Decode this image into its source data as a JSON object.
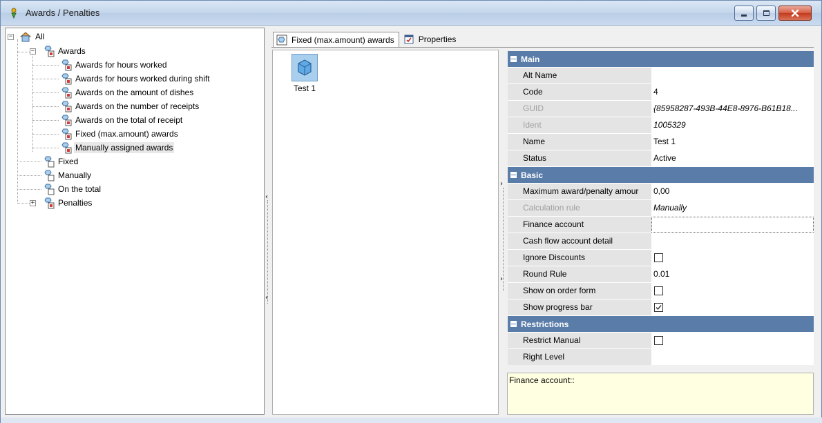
{
  "window": {
    "title": "Awards / Penalties"
  },
  "tree": {
    "root": "All",
    "awards": "Awards",
    "award_children": [
      "Awards for hours worked",
      "Awards for hours worked during shift",
      "Awards on the amount of dishes",
      "Awards on the number of receipts",
      "Awards on the total of receipt",
      "Fixed (max.amount) awards",
      "Manually assigned awards"
    ],
    "siblings": [
      "Fixed",
      "Manually",
      "On the total"
    ],
    "penalties": "Penalties"
  },
  "tabs": [
    {
      "label": "Fixed (max.amount) awards"
    },
    {
      "label": "Properties"
    }
  ],
  "center": {
    "items": [
      {
        "label": "Test 1"
      }
    ]
  },
  "properties": {
    "main": {
      "title": "Main",
      "rows": [
        {
          "name": "Alt Name",
          "value": ""
        },
        {
          "name": "Code",
          "value": "4"
        },
        {
          "name": "GUID",
          "value": "{85958287-493B-44E8-8976-B61B18..."
        },
        {
          "name": "Ident",
          "value": "1005329"
        },
        {
          "name": "Name",
          "value": "Test 1"
        },
        {
          "name": "Status",
          "value": "Active"
        }
      ]
    },
    "basic": {
      "title": "Basic",
      "rows": [
        {
          "name": "Maximum award/penalty amour",
          "value": "0,00"
        },
        {
          "name": "Calculation rule",
          "value": "Manually"
        },
        {
          "name": "Finance account",
          "value": ""
        },
        {
          "name": "Cash flow account detail",
          "value": ""
        },
        {
          "name": "Ignore Discounts",
          "checked": false
        },
        {
          "name": "Round Rule",
          "value": "0.01"
        },
        {
          "name": "Show on order form",
          "checked": false
        },
        {
          "name": "Show progress bar",
          "checked": true
        }
      ]
    },
    "restrictions": {
      "title": "Restrictions",
      "rows": [
        {
          "name": "Restrict Manual",
          "checked": false
        },
        {
          "name": "Right Level",
          "value": ""
        }
      ]
    }
  },
  "description": "Finance account::",
  "icons": {
    "title": "award-icon",
    "root": "house-folder-icon",
    "node": "award-node-icon",
    "tab1": "award-node-icon",
    "tab2": "properties-icon",
    "item": "cube-icon"
  }
}
